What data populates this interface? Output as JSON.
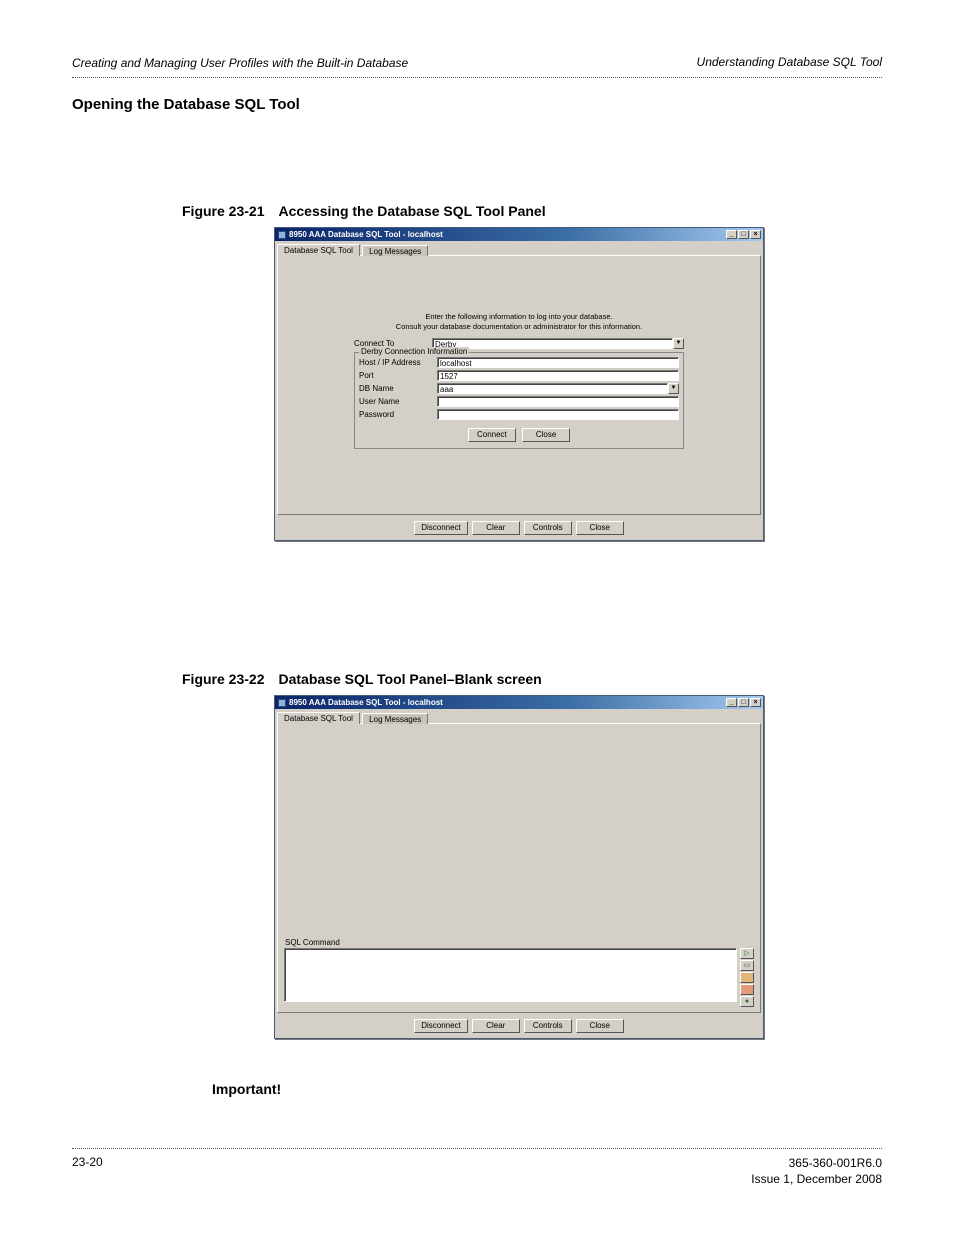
{
  "header": {
    "chapter_title": "Creating and Managing User Profiles with the Built-in Database",
    "topic_title": "Understanding Database SQL Tool"
  },
  "section_heading": "Opening the Database SQL Tool",
  "figure1": {
    "caption": "Figure 23-21 Accessing the Database SQL Tool Panel",
    "window_title": "8950 AAA Database SQL Tool - localhost",
    "tabs": {
      "active": "Database SQL Tool",
      "inactive": "Log Messages"
    },
    "instructions_line1": "Enter the following information to log into your database.",
    "instructions_line2": "Consult your database documentation or administrator for this information.",
    "connect_to_label": "Connect To",
    "connect_to_value": "Derby",
    "fieldset_legend": "Derby Connection Information",
    "fields": {
      "host_label": "Host / IP Address",
      "host_value": "localhost",
      "port_label": "Port",
      "port_value": "1527",
      "dbname_label": "DB Name",
      "dbname_value": "aaa",
      "username_label": "User Name",
      "username_value": "",
      "password_label": "Password",
      "password_value": ""
    },
    "inner_buttons": {
      "connect": "Connect",
      "close": "Close"
    },
    "bottom_buttons": {
      "disconnect": "Disconnect",
      "clear": "Clear",
      "controls": "Controls",
      "close": "Close"
    }
  },
  "figure2": {
    "caption": "Figure 23-22 Database SQL Tool Panel–Blank screen",
    "window_title": "8950 AAA Database SQL Tool - localhost",
    "tabs": {
      "active": "Database SQL Tool",
      "inactive": "Log Messages"
    },
    "sql_label": "SQL Command",
    "sql_value": "",
    "bottom_buttons": {
      "disconnect": "Disconnect",
      "clear": "Clear",
      "controls": "Controls",
      "close": "Close"
    }
  },
  "important_label": "Important!",
  "footer": {
    "page_number": "23-20",
    "doc_number": "365-360-001R6.0",
    "issue": "Issue 1, December 2008"
  }
}
